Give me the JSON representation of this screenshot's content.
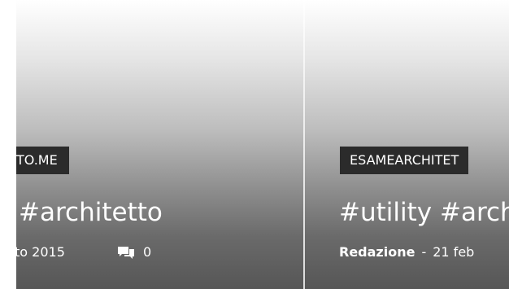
{
  "posts": [
    {
      "category": "TO.ME",
      "title": "#architetto",
      "date": "to 2015",
      "comments_count": "0",
      "comments_icon": "comments-icon"
    },
    {
      "category": "ESAMEARCHITET",
      "title": "#utility #arch",
      "author": "Redazione",
      "separator": "-",
      "date": "21 feb"
    }
  ]
}
